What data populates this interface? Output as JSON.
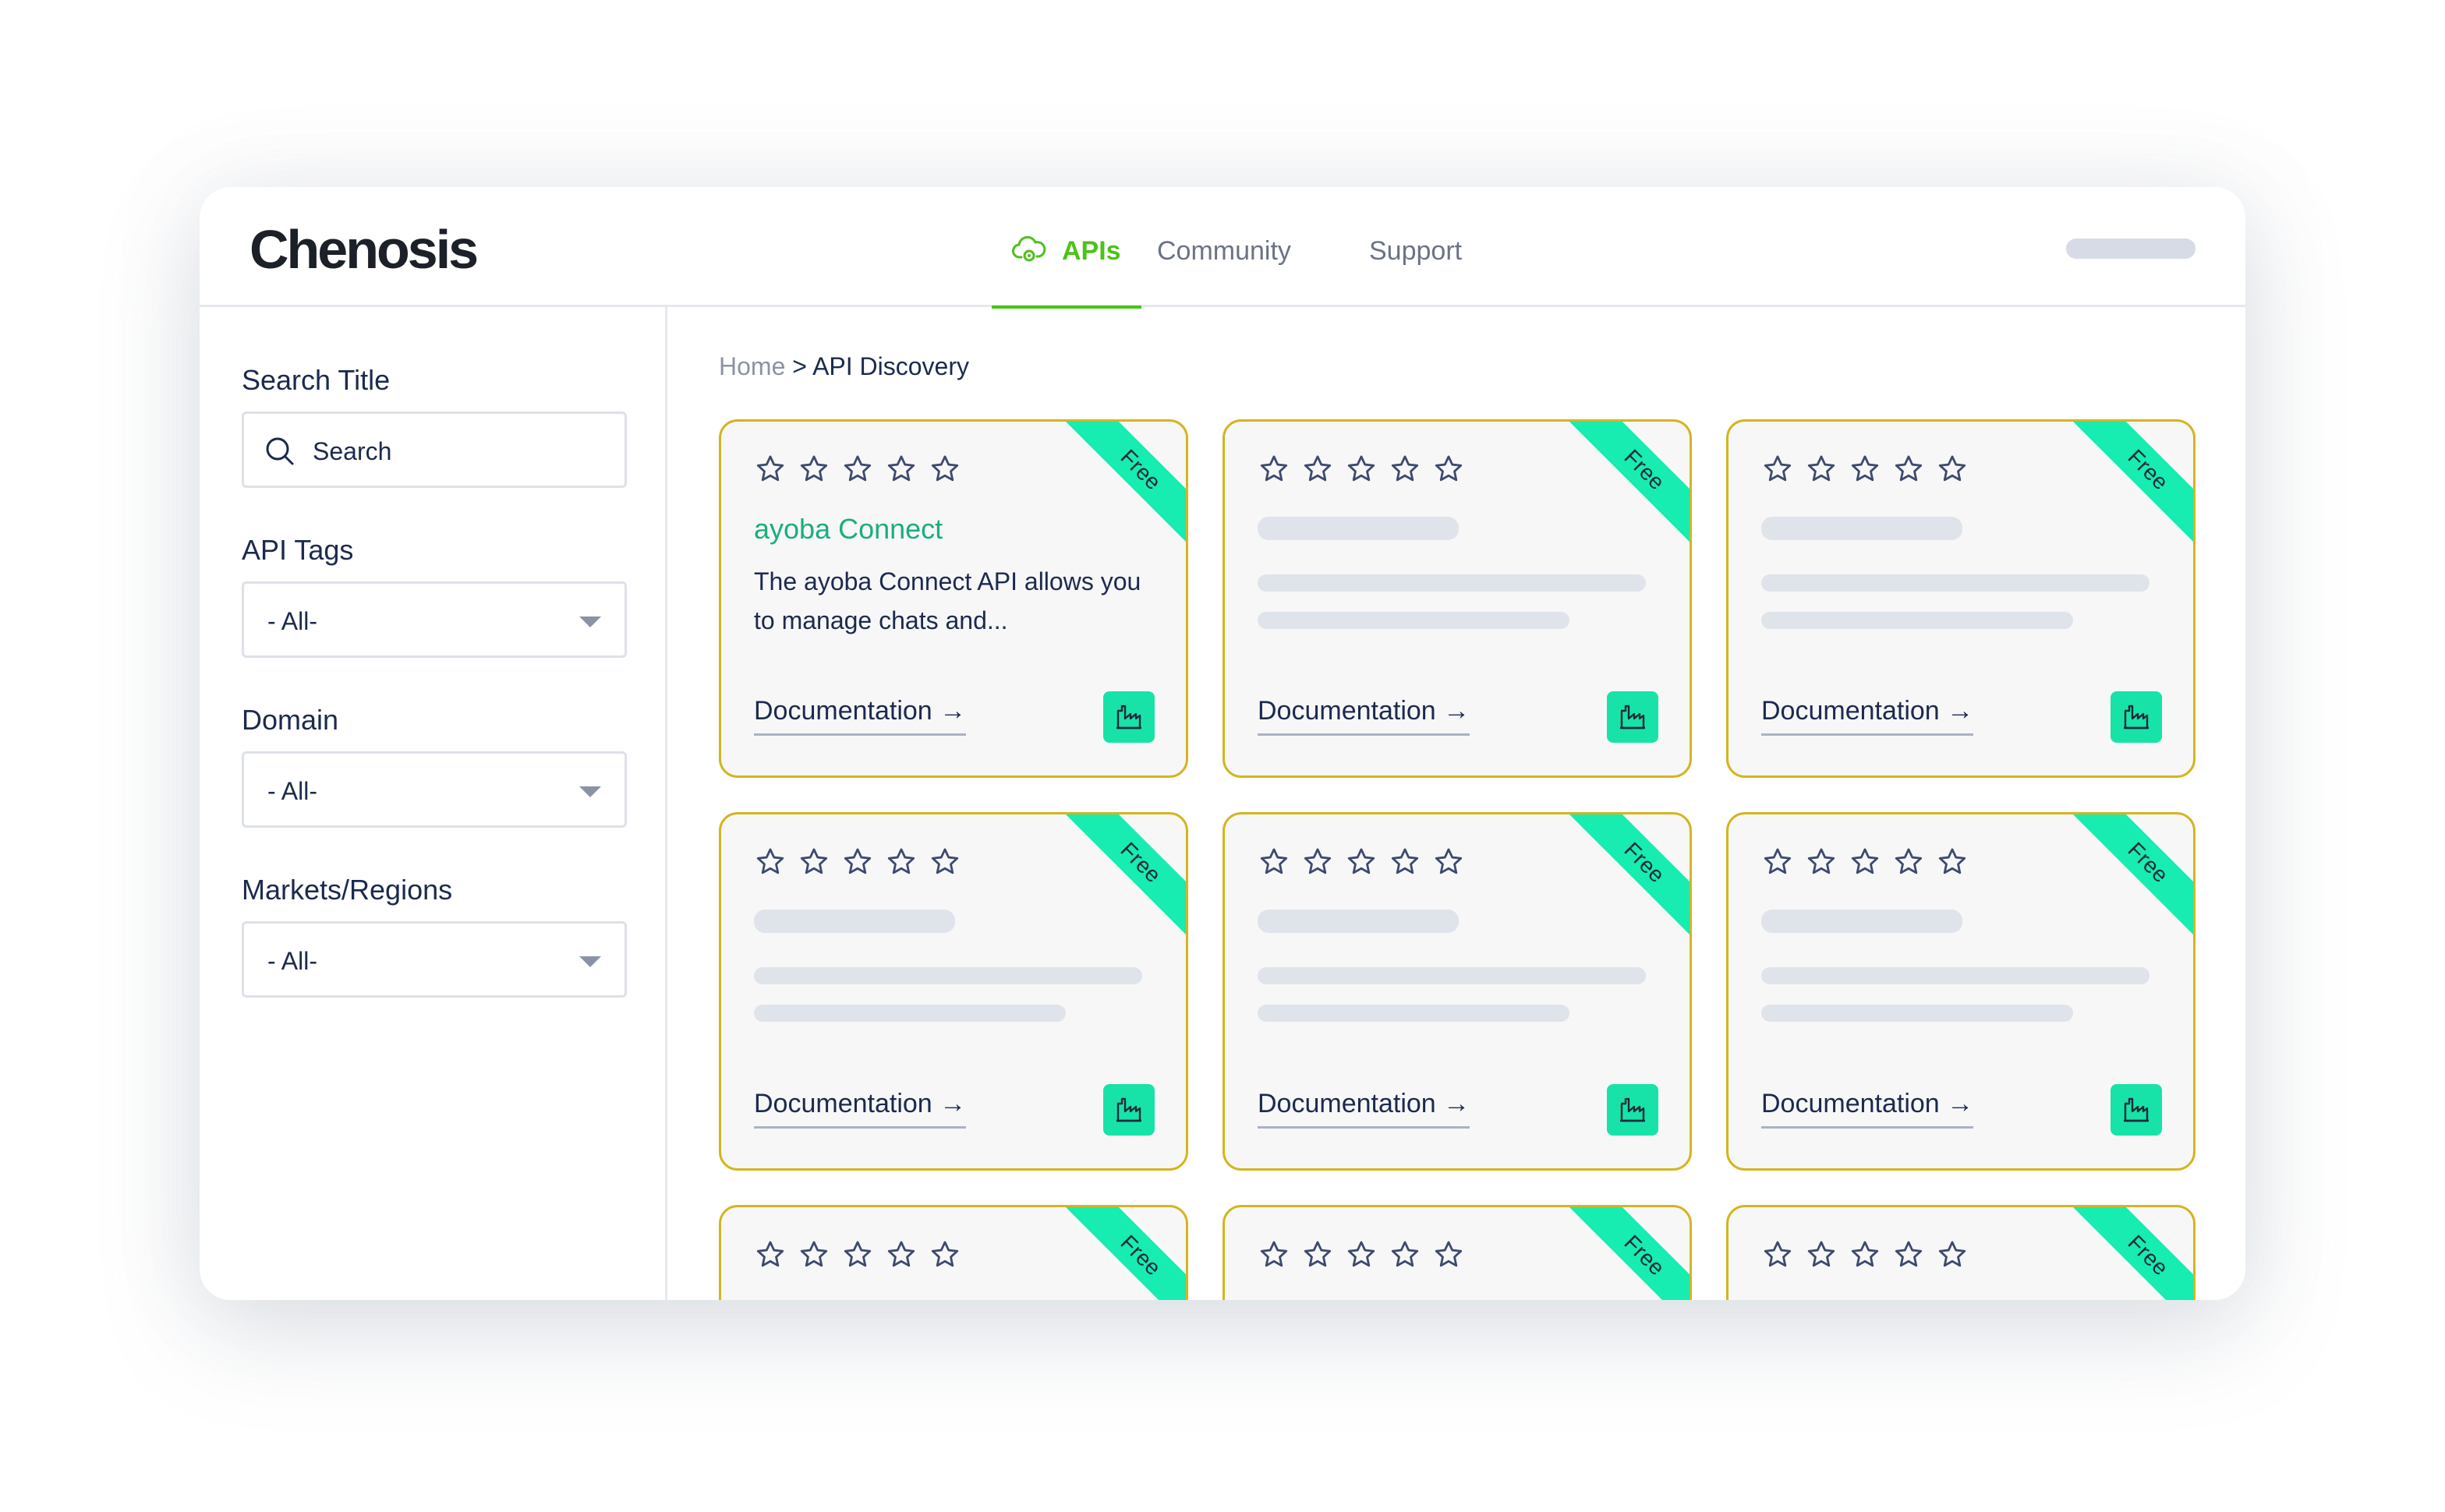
{
  "brand": {
    "name": "Chenosis"
  },
  "nav": {
    "items": [
      {
        "label": "APIs",
        "icon": "cloud-gear-icon",
        "active": true
      },
      {
        "label": "Community"
      },
      {
        "label": "Support"
      }
    ]
  },
  "sidebar": {
    "search": {
      "label": "Search Title",
      "placeholder": "Search"
    },
    "filters": [
      {
        "label": "API Tags",
        "value": "- All-"
      },
      {
        "label": "Domain",
        "value": "- All-"
      },
      {
        "label": "Markets/Regions",
        "value": "- All-"
      }
    ]
  },
  "breadcrumb": {
    "home": "Home",
    "separator": ">",
    "current": "API Discovery"
  },
  "cards": [
    {
      "badge": "Free",
      "rating": 0,
      "title": "ayoba Connect",
      "description": "The ayoba Connect API allows you to manage chats and...",
      "doc_label": "Documentation →"
    },
    {
      "badge": "Free",
      "rating": 0,
      "doc_label": "Documentation →"
    },
    {
      "badge": "Free",
      "rating": 0,
      "doc_label": "Documentation →"
    },
    {
      "badge": "Free",
      "rating": 0,
      "doc_label": "Documentation →"
    },
    {
      "badge": "Free",
      "rating": 0,
      "doc_label": "Documentation →"
    },
    {
      "badge": "Free",
      "rating": 0,
      "doc_label": "Documentation →"
    },
    {
      "badge": "Free",
      "rating": 0
    },
    {
      "badge": "Free",
      "rating": 0
    },
    {
      "badge": "Free",
      "rating": 0
    }
  ],
  "colors": {
    "accent_green": "#4cc21a",
    "badge_teal": "#17ecb1",
    "card_border": "#d4b51f",
    "title_green": "#1aae7e",
    "text_navy": "#1b2a4e"
  }
}
